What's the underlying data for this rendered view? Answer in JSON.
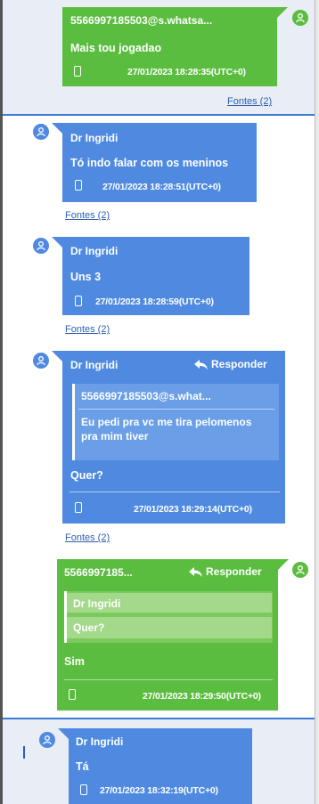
{
  "messages": [
    {
      "direction": "outgoing",
      "sender": "5566997185503@s.whatsa...",
      "text": "Mais tou jogadao",
      "timestamp": "27/01/2023 18:28:35(UTC+0)",
      "sources": "Fontes (2)"
    },
    {
      "direction": "incoming",
      "sender": "Dr Ingridi",
      "text": "Tó indo falar com os meninos",
      "timestamp": "27/01/2023 18:28:51(UTC+0)",
      "sources": "Fontes (2)"
    },
    {
      "direction": "incoming",
      "sender": "Dr Ingridi",
      "text": "Uns 3",
      "timestamp": "27/01/2023 18:28:59(UTC+0)",
      "sources": "Fontes (2)"
    },
    {
      "direction": "incoming",
      "sender": "Dr Ingridi",
      "reply_label": "Responder",
      "quote_sender": "5566997185503@s.what...",
      "quote_text": "Eu pedi pra vc me tira pelomenos pra mim tiver",
      "text": "Quer?",
      "timestamp": "27/01/2023 18:29:14(UTC+0)",
      "sources": "Fontes (2)"
    },
    {
      "direction": "outgoing",
      "sender": "5566997185...",
      "reply_label": "Responder",
      "quote_sender": "Dr Ingridi",
      "quote_text": "Quer?",
      "text": "Sim",
      "timestamp": "27/01/2023 18:29:50(UTC+0)"
    },
    {
      "direction": "incoming",
      "sender": "Dr Ingridi",
      "text": "Tá",
      "timestamp": "27/01/2023 18:32:19(UTC+0)"
    }
  ],
  "icons": {
    "avatar": "user-avatar-icon",
    "device": "phone-icon",
    "reply": "reply-arrow-icon"
  },
  "colors": {
    "incoming_bubble": "#4f8ae0",
    "outgoing_bubble": "#5bbd3f",
    "link": "#2e5fae",
    "selected_band": "#e9edf6"
  }
}
